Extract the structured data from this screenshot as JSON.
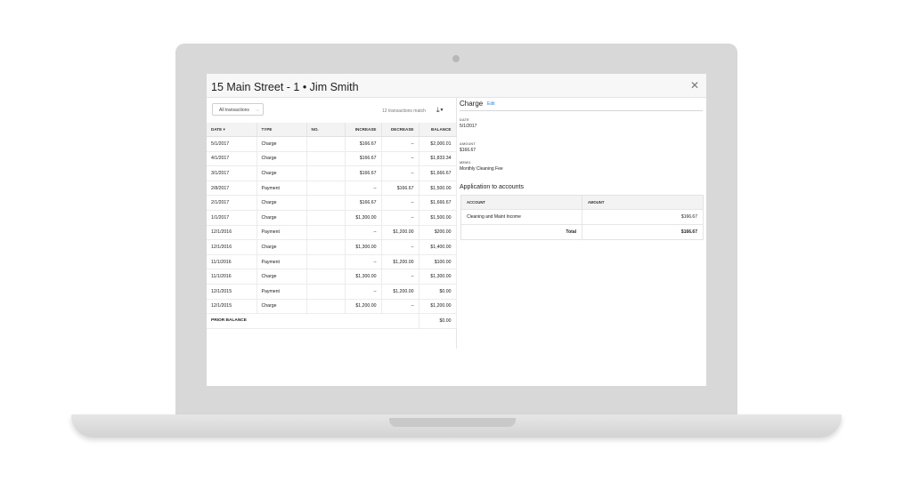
{
  "window": {
    "title": "15 Main Street - 1 • Jim Smith"
  },
  "filter": {
    "label": "All transactions",
    "chevron": "⌵"
  },
  "match_text": "12 transactions match",
  "download_icon": "download-icon",
  "table": {
    "columns": [
      "DATE",
      "TYPE",
      "NO.",
      "INCREASE",
      "DECREASE",
      "BALANCE"
    ],
    "sort_marker": "▾",
    "rows": [
      [
        "5/1/2017",
        "Charge",
        "",
        "$166.67",
        "–",
        "$2,000.01"
      ],
      [
        "4/1/2017",
        "Charge",
        "",
        "$166.67",
        "–",
        "$1,833.34"
      ],
      [
        "3/1/2017",
        "Charge",
        "",
        "$166.67",
        "–",
        "$1,666.67"
      ],
      [
        "2/8/2017",
        "Payment",
        "",
        "–",
        "$166.67",
        "$1,500.00"
      ],
      [
        "2/1/2017",
        "Charge",
        "",
        "$166.67",
        "–",
        "$1,666.67"
      ],
      [
        "1/1/2017",
        "Charge",
        "",
        "$1,300.00",
        "–",
        "$1,500.00"
      ],
      [
        "12/1/2016",
        "Payment",
        "",
        "–",
        "$1,200.00",
        "$200.00"
      ],
      [
        "12/1/2016",
        "Charge",
        "",
        "$1,300.00",
        "–",
        "$1,400.00"
      ],
      [
        "11/1/2016",
        "Payment",
        "",
        "–",
        "$1,200.00",
        "$100.00"
      ],
      [
        "11/1/2016",
        "Charge",
        "",
        "$1,300.00",
        "–",
        "$1,300.00"
      ],
      [
        "12/1/2015",
        "Payment",
        "",
        "–",
        "$1,200.00",
        "$0.00"
      ],
      [
        "12/1/2015",
        "Charge",
        "",
        "$1,200.00",
        "–",
        "$1,200.00"
      ]
    ],
    "prior_balance": {
      "label": "PRIOR BALANCE",
      "value": "$0.00"
    }
  },
  "detail": {
    "title": "Charge",
    "edit_label": "Edit",
    "date_label": "DATE",
    "date": "5/1/2017",
    "amount_label": "AMOUNT",
    "amount": "$166.67",
    "memo_label": "MEMO",
    "memo": "Monthly Cleaning Fee",
    "section_title": "Application to accounts",
    "accounts": {
      "columns": [
        "ACCOUNT",
        "AMOUNT"
      ],
      "rows": [
        [
          "Cleaning and Maint Income",
          "$166.67"
        ]
      ],
      "total_label": "Total",
      "total": "$166.67"
    }
  }
}
